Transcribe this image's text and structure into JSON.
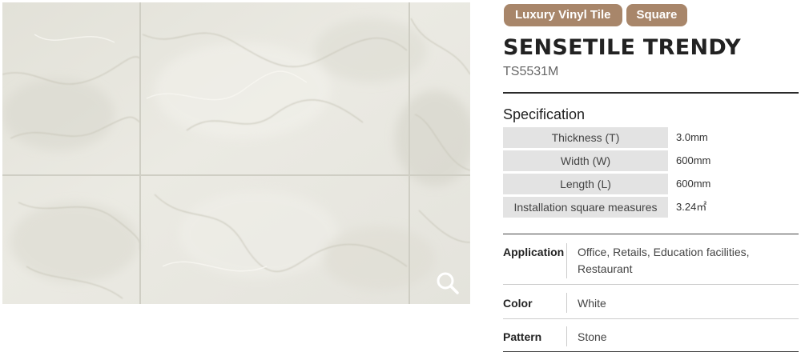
{
  "tags": [
    "Luxury Vinyl Tile",
    "Square"
  ],
  "product": {
    "name": "SENSETILE TRENDY",
    "code": "TS5531M"
  },
  "specification": {
    "heading": "Specification",
    "rows": [
      {
        "label": "Thickness (T)",
        "value": "3.0mm"
      },
      {
        "label": "Width (W)",
        "value": "600mm"
      },
      {
        "label": "Length (L)",
        "value": "600mm"
      },
      {
        "label": "Installation square measures",
        "value": "3.24㎡"
      }
    ]
  },
  "details": {
    "application": {
      "label": "Application",
      "value": "Office, Retails, Education facilities, Restaurant"
    },
    "color": {
      "label": "Color",
      "value": "White"
    },
    "pattern": {
      "label": "Pattern",
      "value": "Stone"
    }
  },
  "icons": {
    "zoom": "search-icon"
  },
  "colors": {
    "tag_background": "#a8866a",
    "spec_label_background": "#e3e3e3"
  }
}
